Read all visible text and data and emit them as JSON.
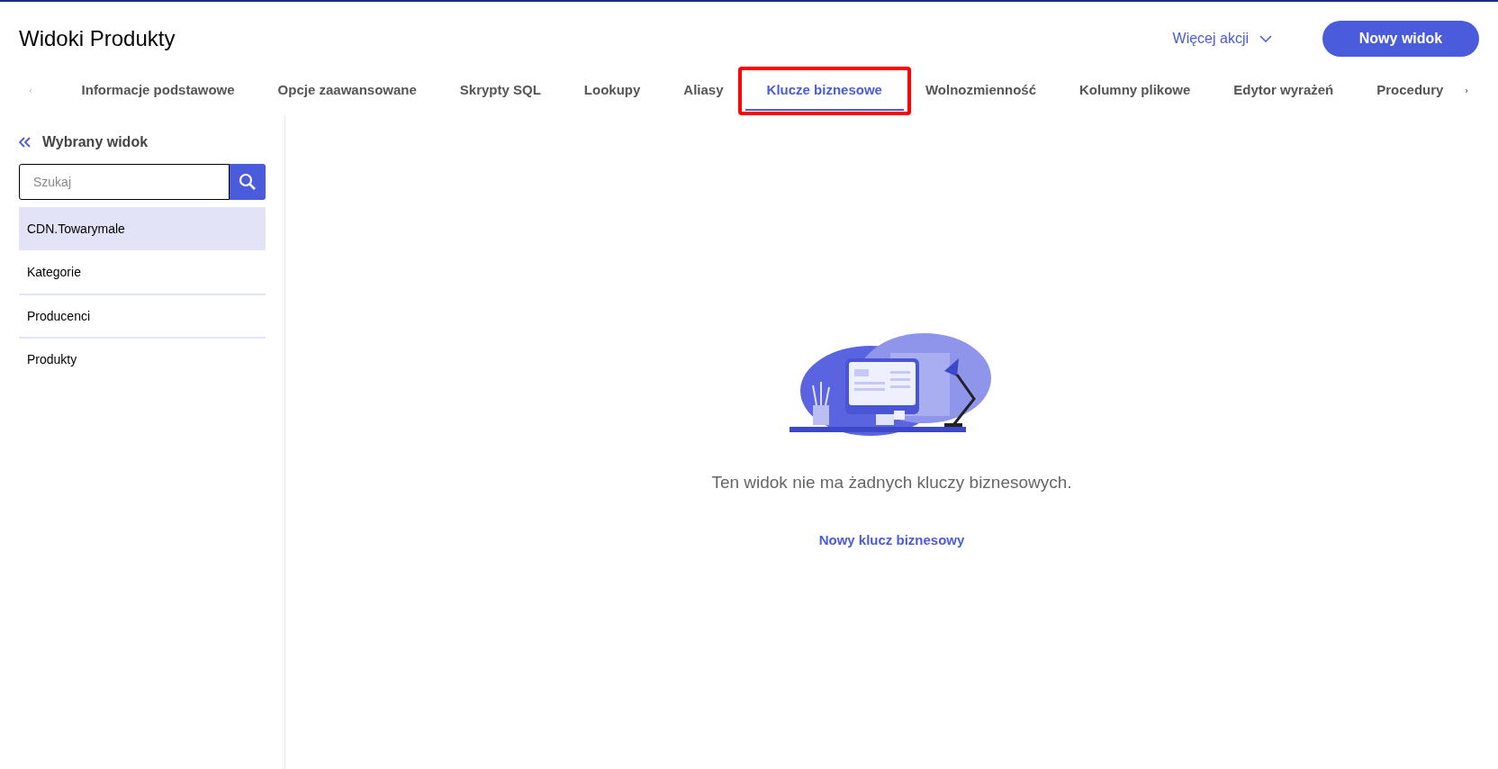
{
  "header": {
    "title": "Widoki Produkty",
    "more_actions": "Więcej akcji",
    "new_button": "Nowy widok"
  },
  "tabs": [
    {
      "label": "Informacje podstawowe",
      "selected": false,
      "highlighted": false
    },
    {
      "label": "Opcje zaawansowane",
      "selected": false,
      "highlighted": false
    },
    {
      "label": "Skrypty SQL",
      "selected": false,
      "highlighted": false
    },
    {
      "label": "Lookupy",
      "selected": false,
      "highlighted": false
    },
    {
      "label": "Aliasy",
      "selected": false,
      "highlighted": false
    },
    {
      "label": "Klucze biznesowe",
      "selected": true,
      "highlighted": true
    },
    {
      "label": "Wolnozmienność",
      "selected": false,
      "highlighted": false
    },
    {
      "label": "Kolumny plikowe",
      "selected": false,
      "highlighted": false
    },
    {
      "label": "Edytor wyrażeń",
      "selected": false,
      "highlighted": false
    },
    {
      "label": "Procedury",
      "selected": false,
      "highlighted": false
    }
  ],
  "sidebar": {
    "title": "Wybrany widok",
    "search": {
      "placeholder": "Szukaj"
    },
    "items": [
      {
        "label": "CDN.Towarymale",
        "selected": true
      },
      {
        "label": "Kategorie",
        "selected": false
      },
      {
        "label": "Producenci",
        "selected": false
      },
      {
        "label": "Produkty",
        "selected": false
      }
    ]
  },
  "empty_state": {
    "message": "Ten widok nie ma żadnych kluczy biznesowych.",
    "link": "Nowy klucz biznesowy"
  }
}
